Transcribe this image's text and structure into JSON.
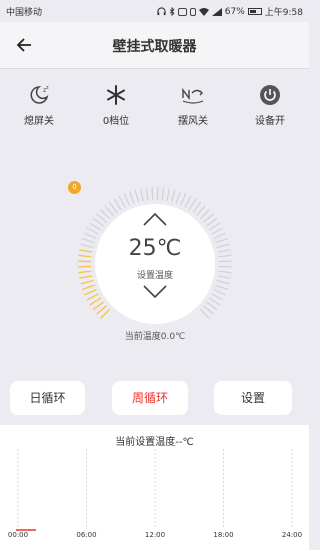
{
  "status_bar": {
    "carrier": "中国移动",
    "battery": "67%",
    "time": "上午9:58",
    "battery_level": 0.67,
    "icons": [
      "headset-icon",
      "bluetooth-icon",
      "nfc-icon",
      "vibrate-icon",
      "wifi-icon",
      "signal-icon",
      "battery-icon"
    ]
  },
  "header": {
    "title": "壁挂式取暖器",
    "back_icon": "back-arrow-icon"
  },
  "modes": [
    {
      "label": "熄屏关",
      "icon": "moon-sleep-icon"
    },
    {
      "label": "0档位",
      "icon": "snowflake-icon"
    },
    {
      "label": "摆风关",
      "icon": "swing-icon"
    },
    {
      "label": "设备开",
      "icon": "power-icon"
    }
  ],
  "dial": {
    "badge": "0",
    "temperature": "25℃",
    "set_label": "设置温度",
    "current_temp": "当前温度0.0℃",
    "active_color": "#f5c33b",
    "inactive_color": "#d0d0d6"
  },
  "buttons": {
    "daily": "日循环",
    "weekly": "周循环",
    "settings": "设置",
    "active_color": "#f0302a"
  },
  "chart_data": {
    "type": "line",
    "title": "当前设置温度--℃",
    "x_ticks": [
      "00:00",
      "06:00",
      "12:00",
      "18:00",
      "24:00"
    ],
    "series": []
  }
}
